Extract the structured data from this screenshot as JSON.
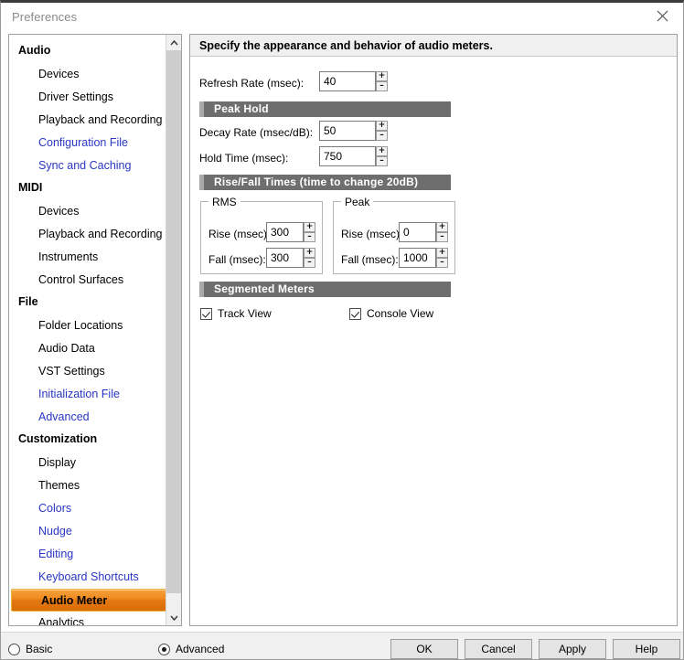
{
  "window": {
    "title": "Preferences",
    "close_icon": "close-icon"
  },
  "sidebar": {
    "scroll": {
      "up_icon": "chevron-up-icon",
      "down_icon": "chevron-down-icon"
    },
    "entries": [
      {
        "label": "Audio",
        "kind": "group",
        "tier": "basic"
      },
      {
        "label": "Devices",
        "kind": "item",
        "tier": "basic"
      },
      {
        "label": "Driver Settings",
        "kind": "item",
        "tier": "basic"
      },
      {
        "label": "Playback and Recording",
        "kind": "item",
        "tier": "basic"
      },
      {
        "label": "Configuration File",
        "kind": "item",
        "tier": "advanced"
      },
      {
        "label": "Sync and Caching",
        "kind": "item",
        "tier": "advanced"
      },
      {
        "label": "MIDI",
        "kind": "group",
        "tier": "basic"
      },
      {
        "label": "Devices",
        "kind": "item",
        "tier": "basic"
      },
      {
        "label": "Playback and Recording",
        "kind": "item",
        "tier": "basic"
      },
      {
        "label": "Instruments",
        "kind": "item",
        "tier": "basic"
      },
      {
        "label": "Control Surfaces",
        "kind": "item",
        "tier": "basic"
      },
      {
        "label": "File",
        "kind": "group",
        "tier": "basic"
      },
      {
        "label": "Folder Locations",
        "kind": "item",
        "tier": "basic"
      },
      {
        "label": "Audio Data",
        "kind": "item",
        "tier": "basic"
      },
      {
        "label": "VST Settings",
        "kind": "item",
        "tier": "basic"
      },
      {
        "label": "Initialization File",
        "kind": "item",
        "tier": "advanced"
      },
      {
        "label": "Advanced",
        "kind": "item",
        "tier": "advanced"
      },
      {
        "label": "Customization",
        "kind": "group",
        "tier": "basic"
      },
      {
        "label": "Display",
        "kind": "item",
        "tier": "basic"
      },
      {
        "label": "Themes",
        "kind": "item",
        "tier": "basic"
      },
      {
        "label": "Colors",
        "kind": "item",
        "tier": "advanced"
      },
      {
        "label": "Nudge",
        "kind": "item",
        "tier": "advanced"
      },
      {
        "label": "Editing",
        "kind": "item",
        "tier": "advanced"
      },
      {
        "label": "Keyboard Shortcuts",
        "kind": "item",
        "tier": "advanced"
      },
      {
        "label": "Audio Meter",
        "kind": "item",
        "tier": "basic",
        "selected": true
      },
      {
        "label": "Analytics",
        "kind": "item",
        "tier": "basic"
      }
    ]
  },
  "main": {
    "banner": "Specify the appearance and behavior of audio meters.",
    "refresh": {
      "label": "Refresh Rate (msec):",
      "value": "40",
      "increment_label": "+",
      "decrement_label": "–"
    },
    "peak_hold": {
      "section_title": "Peak Hold",
      "decay": {
        "label": "Decay Rate (msec/dB):",
        "value": "50"
      },
      "hold": {
        "label": "Hold Time (msec):",
        "value": "750"
      }
    },
    "rise_fall": {
      "section_title": "Rise/Fall Times (time to change 20dB)",
      "rms": {
        "title": "RMS",
        "rise": {
          "label": "Rise (msec):",
          "value": "300"
        },
        "fall": {
          "label": "Fall (msec):",
          "value": "300"
        }
      },
      "peak": {
        "title": "Peak",
        "rise": {
          "label": "Rise (msec):",
          "value": "0"
        },
        "fall": {
          "label": "Fall (msec):",
          "value": "1000"
        }
      }
    },
    "segmented": {
      "section_title": "Segmented Meters",
      "track_view": {
        "label": "Track View",
        "checked": true
      },
      "console_view": {
        "label": "Console View",
        "checked": true
      }
    }
  },
  "footer": {
    "mode": {
      "basic": {
        "label": "Basic",
        "selected": false
      },
      "advanced": {
        "label": "Advanced",
        "selected": true
      }
    },
    "buttons": {
      "ok": "OK",
      "cancel": "Cancel",
      "apply": "Apply",
      "help": "Help"
    }
  },
  "colors": {
    "selection_orange": "#ef8b20",
    "advanced_link_blue": "#2a36c4",
    "section_bar_gray": "#6e6e6e"
  }
}
